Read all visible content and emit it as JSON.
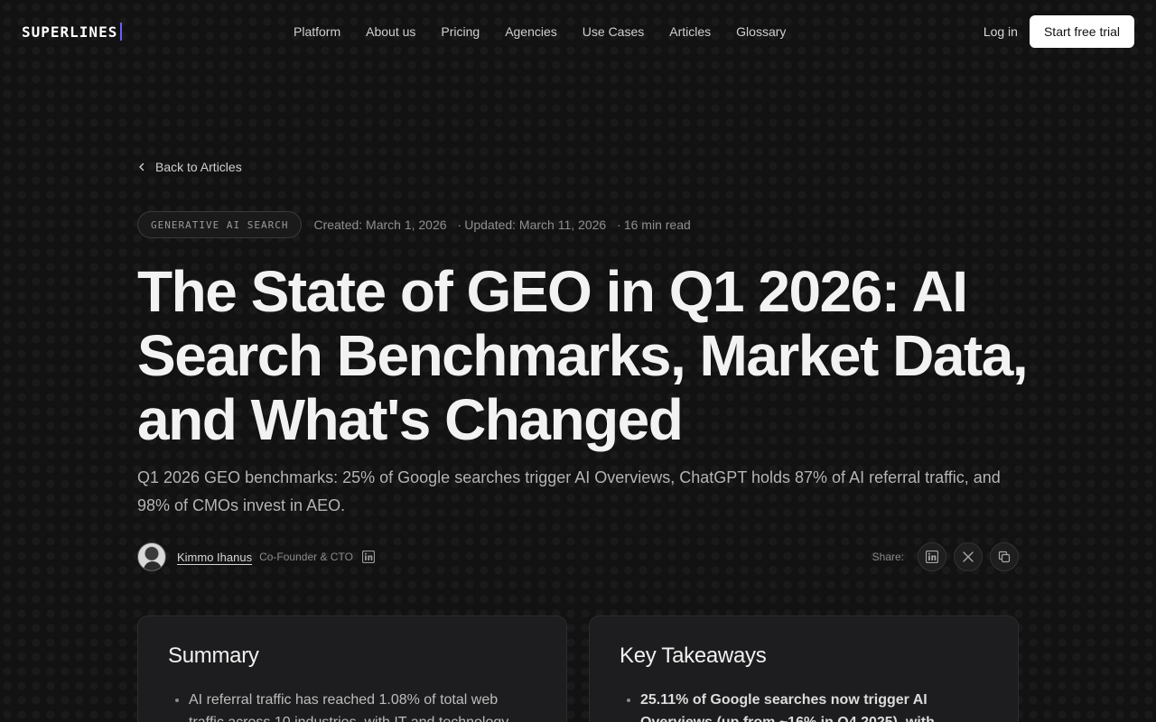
{
  "nav": {
    "logo": "SUPERLINES",
    "links": [
      "Platform",
      "About us",
      "Pricing",
      "Agencies",
      "Use Cases",
      "Articles",
      "Glossary"
    ],
    "login": "Log in",
    "cta": "Start free trial"
  },
  "article": {
    "back_label": "Back to Articles",
    "tag": "GENERATIVE AI SEARCH",
    "created": "Created: March 1, 2026",
    "updated": "Updated: March 11, 2026",
    "read_time": "16 min read",
    "title": "The State of GEO in Q1 2026: AI Search Benchmarks, Market Data, and What's Changed",
    "subtitle": "Q1 2026 GEO benchmarks: 25% of Google searches trigger AI Overviews, ChatGPT holds 87% of AI referral traffic, and 98% of CMOs invest in AEO.",
    "author": {
      "name": "Kimmo Ihanus",
      "role": "Co-Founder & CTO"
    },
    "share_label": "Share:"
  },
  "summary": {
    "title": "Summary",
    "items": [
      "AI referral traffic has reached 1.08% of total web traffic across 10 industries, with IT and technology"
    ]
  },
  "takeaways": {
    "title": "Key Takeaways",
    "items": [
      "25.11% of Google searches now trigger AI Overviews (up from ~16% in Q4 2025), with"
    ]
  },
  "icons": {
    "back": "chevron-left-icon",
    "linkedin": "linkedin-icon",
    "x": "x-icon",
    "copy": "copy-icon"
  },
  "colors": {
    "background": "#121212",
    "accent": "#6d5dfc",
    "cta_bg": "#ffffff"
  }
}
